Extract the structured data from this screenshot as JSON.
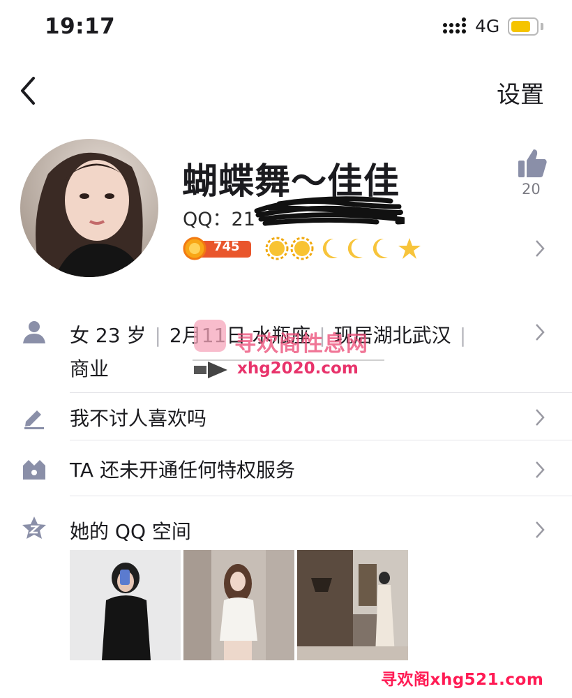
{
  "status_bar": {
    "time": "19:17",
    "network": "4G",
    "battery_level": 0.8
  },
  "nav": {
    "settings_label": "设置"
  },
  "profile": {
    "nickname": "蝴蝶舞～佳佳",
    "qq_prefix": "QQ：",
    "qq_visible": "21",
    "likes": "20",
    "badge_number": "745"
  },
  "info": {
    "gender_age": "女 23 岁",
    "birthday_sign": "2月11日 水瓶座",
    "location": "现居湖北武汉",
    "sep": "|",
    "occupation": "商业"
  },
  "rows": {
    "signature": "我不讨人喜欢吗",
    "privilege": "TA 还未开通任何特权服务",
    "qzone": "她的 QQ 空间"
  },
  "watermarks": {
    "site_name": "寻欢阁性息网",
    "site_url": "xhg2020.com",
    "footer": "寻欢阁xhg521.com"
  },
  "colors": {
    "accent_icon": "#8a8fa8",
    "battery": "#f5c400",
    "watermark": "#e8336b"
  }
}
